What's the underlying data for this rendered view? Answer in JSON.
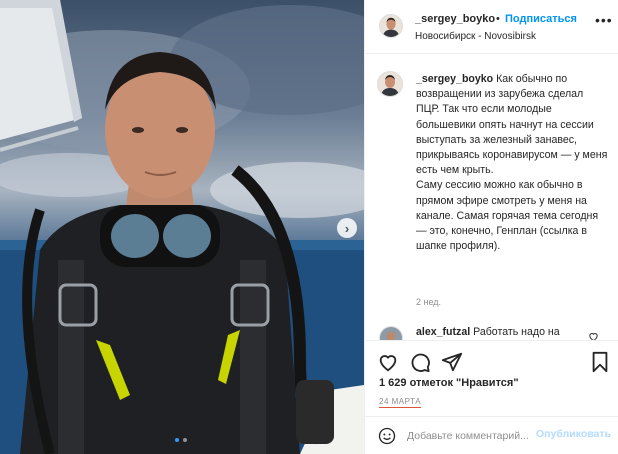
{
  "post": {
    "image": {
      "alt": "",
      "carousel_dots": 2,
      "active_dot": 0
    }
  },
  "header": {
    "username": "_sergey_boyko",
    "separator": "•",
    "follow_label": "Подписаться",
    "location": "Новосибирск - Novosibirsk",
    "more_icon": "more-horizontal-icon"
  },
  "caption": {
    "username": "_sergey_boyko",
    "text": "Как обычно по возвращении из зарубежа сделал ПЦР. Так что если молодые большевики опять начнут на сессии выступать за железный занавес, прикрываясь коронавирусом — у меня есть чем крыть.",
    "text2": "Саму сессию можно как обычно в прямом эфире смотреть у меня на канале. Самая горячая тема сегодня — это, конечно, Генплан (ссылка в шапке профиля).",
    "time": "2 нед."
  },
  "comment": {
    "username": "alex_futzal",
    "text": "Работать надо на город а не по загранкам отдыхать. Еще поработать не успел толком а уже устал"
  },
  "actions": {
    "like_icon": "heart-icon",
    "comment_icon": "comment-icon",
    "share_icon": "share-icon",
    "save_icon": "bookmark-icon"
  },
  "likes_text": "1 629 отметок \"Нравится\"",
  "date": "24 МАРТА",
  "add_comment": {
    "placeholder": "Добавьте комментарий...",
    "publish_label": "Опубликовать"
  },
  "colors": {
    "link_blue": "#0095f6",
    "publish_disabled": "#b3dbff",
    "muted": "#8e8e8e",
    "date_underline": "#e0533b"
  }
}
